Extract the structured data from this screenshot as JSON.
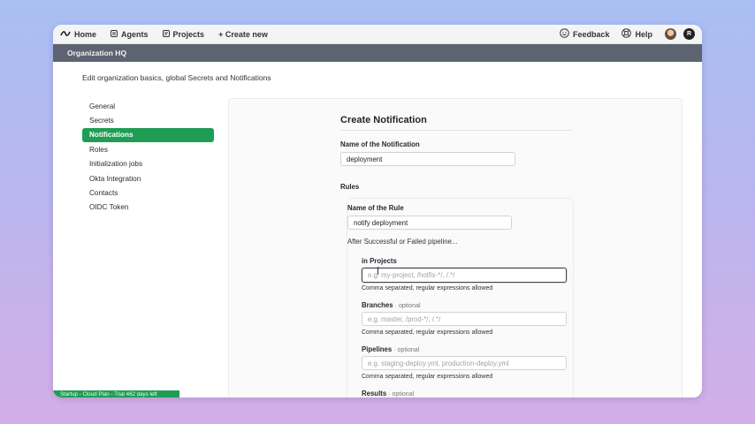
{
  "topnav": {
    "home": "Home",
    "agents": "Agents",
    "projects": "Projects",
    "create_new": "+ Create new",
    "feedback": "Feedback",
    "help": "Help",
    "avatar_initial": "R"
  },
  "org": {
    "name": "Organization HQ"
  },
  "page": {
    "subtitle": "Edit organization basics, global Secrets and Notifications"
  },
  "sidebar": {
    "items": [
      {
        "label": "General"
      },
      {
        "label": "Secrets"
      },
      {
        "label": "Notifications"
      },
      {
        "label": "Roles"
      },
      {
        "label": "Initialization jobs"
      },
      {
        "label": "Okta Integration"
      },
      {
        "label": "Contacts"
      },
      {
        "label": "OIDC Token"
      }
    ]
  },
  "form": {
    "title": "Create Notification",
    "name_label": "Name of the Notification",
    "name_value": "deployment",
    "rules_label": "Rules",
    "rule": {
      "name_label": "Name of the Rule",
      "name_value": "notify deployment",
      "trigger_text": "After Successful or Failed pipeline...",
      "projects_label": "in Projects",
      "projects_placeholder": "e.g. my-project, /hotfix-*/, /.*/",
      "projects_hint": "Comma separated, regular expressions allowed",
      "branches_label": "Branches",
      "optional_tag": "· optional",
      "branches_placeholder": "e.g. master, /prod-*/, /.*/",
      "branches_hint": "Comma separated, regular expressions allowed",
      "pipelines_label": "Pipelines",
      "pipelines_placeholder": "e.g. staging-deploy.yml, production-deploy.yml",
      "pipelines_hint": "Comma separated, regular expressions allowed",
      "results_label": "Results"
    }
  },
  "status": {
    "plan_text": "Startup - Cloud Plan - Trial 462 days left"
  },
  "colors": {
    "accent_green": "#1f9d55",
    "org_bar": "#5b6470"
  }
}
